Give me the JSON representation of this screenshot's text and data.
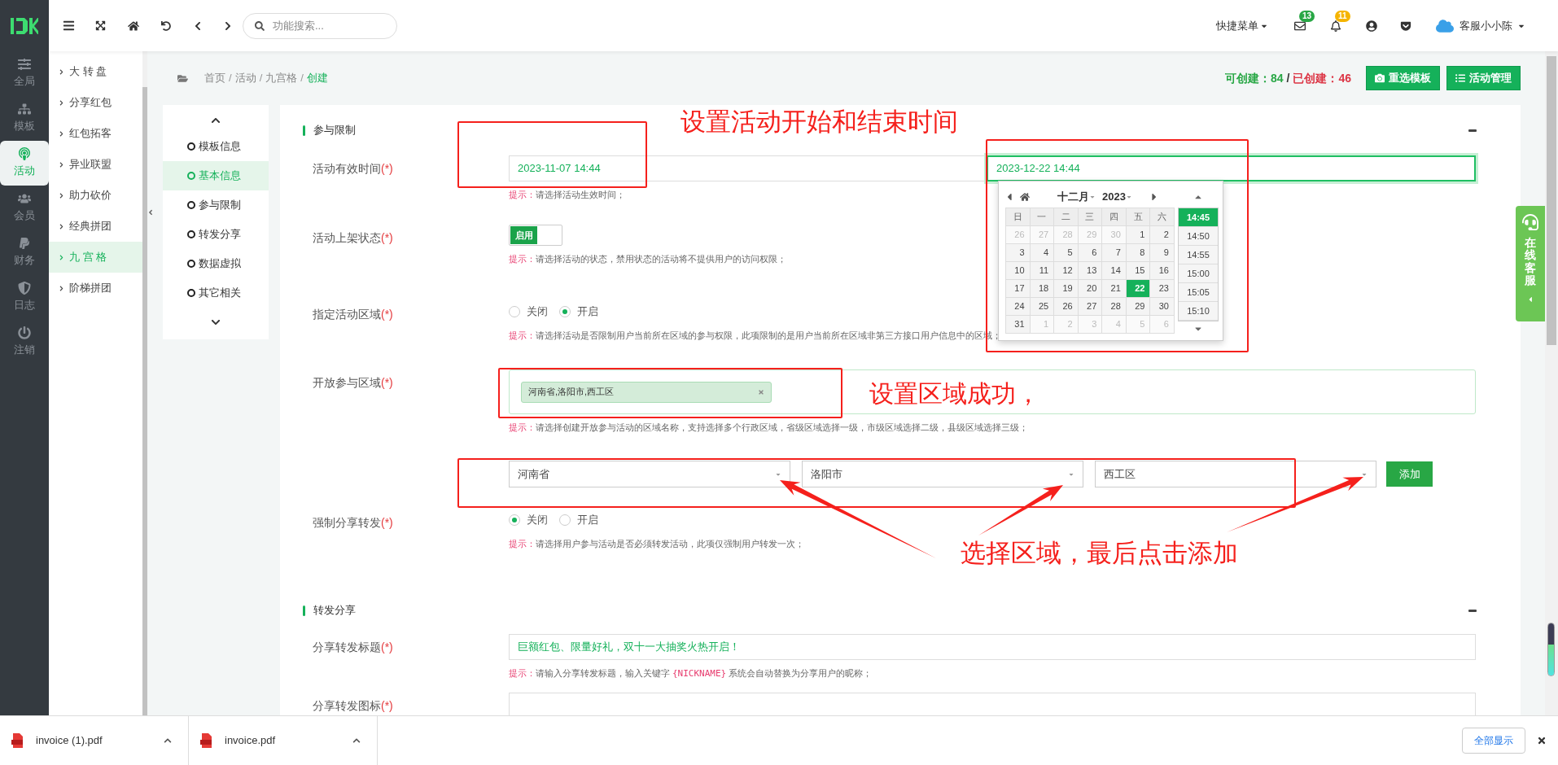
{
  "rail": [
    {
      "label": "全局",
      "selected": false
    },
    {
      "label": "模板",
      "selected": false
    },
    {
      "label": "活动",
      "selected": true
    },
    {
      "label": "会员",
      "selected": false
    },
    {
      "label": "财务",
      "selected": false
    },
    {
      "label": "日志",
      "selected": false
    },
    {
      "label": "注销",
      "selected": false
    }
  ],
  "topbar": {
    "search": {
      "placeholder": "功能搜索..."
    },
    "quick_menu": "快捷菜单",
    "mail_badge": "13",
    "bell_badge": "11",
    "user": "客服小小陈"
  },
  "submenu": [
    {
      "label": "大 转 盘",
      "selected": false
    },
    {
      "label": "分享红包",
      "selected": false
    },
    {
      "label": "红包拓客",
      "selected": false
    },
    {
      "label": "异业联盟",
      "selected": false
    },
    {
      "label": "助力砍价",
      "selected": false
    },
    {
      "label": "经典拼团",
      "selected": false
    },
    {
      "label": "九 宫 格",
      "selected": true
    },
    {
      "label": "阶梯拼团",
      "selected": false
    }
  ],
  "breadcrumb": {
    "separator": "/",
    "items": [
      {
        "label": "首页",
        "current": false
      },
      {
        "label": "活动",
        "current": false
      },
      {
        "label": "九宫格",
        "current": false
      },
      {
        "label": "创建",
        "current": true
      }
    ]
  },
  "quota": {
    "available": "可创建：84",
    "separator": "/",
    "created": "已创建：46"
  },
  "actions": [
    "重选模板",
    "活动管理"
  ],
  "anchor_nav": [
    {
      "label": "模板信息",
      "selected": false
    },
    {
      "label": "基本信息",
      "selected": true
    },
    {
      "label": "参与限制",
      "selected": false
    },
    {
      "label": "转发分享",
      "selected": false
    },
    {
      "label": "数据虚拟",
      "selected": false
    },
    {
      "label": "其它相关",
      "selected": false
    }
  ],
  "sections": [
    {
      "title": "参与限制",
      "fields": [
        {
          "kind": "daterange",
          "label": "活动有效时间",
          "required": "(*)",
          "start": "2023-11-07 14:44",
          "end": "2023-12-22 14:44",
          "hint_label": "提示：",
          "hint": "请选择活动生效时间；"
        },
        {
          "kind": "toggle",
          "label": "活动上架状态",
          "required": "(*)",
          "on": true,
          "on_text": "启用",
          "hint_label": "提示：",
          "hint": "请选择活动的状态，禁用状态的活动将不提供用户的访问权限；"
        },
        {
          "kind": "radio",
          "label": "指定活动区域",
          "required": "(*)",
          "options": [
            {
              "label": "关闭",
              "selected": false
            },
            {
              "label": "开启",
              "selected": true
            }
          ],
          "hint_label": "提示：",
          "hint": " 请选择活动是否限制用户当前所在区域的参与权限，此项限制的是用户当前所在区域非第三方接口用户信息中的区域；"
        },
        {
          "kind": "tags",
          "label": "开放参与区域",
          "required": "(*)",
          "tags": [
            {
              "label": "河南省,洛阳市,西工区"
            }
          ],
          "hint_label": "提示：",
          "hint": " 请选择创建开放参与活动的区域名称，支持选择多个行政区域，省级区域选择一级，市级区域选择二级，县级区域选择三级；"
        },
        {
          "kind": "selects",
          "selects": [
            {
              "value": "河南省"
            },
            {
              "value": "洛阳市"
            },
            {
              "value": "西工区"
            }
          ],
          "button": "添加"
        },
        {
          "kind": "radio",
          "label": "强制分享转发",
          "required": "(*)",
          "options": [
            {
              "label": "关闭",
              "selected": true
            },
            {
              "label": "开启",
              "selected": false
            }
          ],
          "hint_label": "提示：",
          "hint": " 请选择用户参与活动是否必须转发活动，此项仅强制用户转发一次；"
        }
      ]
    },
    {
      "title": "转发分享",
      "fields": [
        {
          "kind": "text",
          "label": "分享转发标题",
          "required": "(*)",
          "value": "巨额红包、限量好礼，双十一大抽奖火热开启！",
          "hint_label": "提示：",
          "hint": "请输入分享转发标题，输入关键字",
          "hint_code": "{NICKNAME}",
          "hint_after": "系统会自动替换为分享用户的昵称；"
        },
        {
          "kind": "image",
          "label": "分享转发图标",
          "required": "(*)"
        }
      ]
    }
  ],
  "calendar": {
    "month": "十二月",
    "year": "2023",
    "weekdays": [
      "日",
      "一",
      "二",
      "三",
      "四",
      "五",
      "六"
    ],
    "weeks": [
      [
        {
          "label": "26",
          "muted": true,
          "selected": false
        },
        {
          "label": "27",
          "muted": true,
          "selected": false
        },
        {
          "label": "28",
          "muted": true,
          "selected": false
        },
        {
          "label": "29",
          "muted": true,
          "selected": false
        },
        {
          "label": "30",
          "muted": true,
          "selected": false
        },
        {
          "label": "1",
          "muted": false,
          "selected": false
        },
        {
          "label": "2",
          "muted": false,
          "selected": false
        }
      ],
      [
        {
          "label": "3",
          "muted": false,
          "selected": false
        },
        {
          "label": "4",
          "muted": false,
          "selected": false
        },
        {
          "label": "5",
          "muted": false,
          "selected": false
        },
        {
          "label": "6",
          "muted": false,
          "selected": false
        },
        {
          "label": "7",
          "muted": false,
          "selected": false
        },
        {
          "label": "8",
          "muted": false,
          "selected": false
        },
        {
          "label": "9",
          "muted": false,
          "selected": false
        }
      ],
      [
        {
          "label": "10",
          "muted": false,
          "selected": false
        },
        {
          "label": "11",
          "muted": false,
          "selected": false
        },
        {
          "label": "12",
          "muted": false,
          "selected": false
        },
        {
          "label": "13",
          "muted": false,
          "selected": false
        },
        {
          "label": "14",
          "muted": false,
          "selected": false
        },
        {
          "label": "15",
          "muted": false,
          "selected": false
        },
        {
          "label": "16",
          "muted": false,
          "selected": false
        }
      ],
      [
        {
          "label": "17",
          "muted": false,
          "selected": false
        },
        {
          "label": "18",
          "muted": false,
          "selected": false
        },
        {
          "label": "19",
          "muted": false,
          "selected": false
        },
        {
          "label": "20",
          "muted": false,
          "selected": false
        },
        {
          "label": "21",
          "muted": false,
          "selected": false
        },
        {
          "label": "22",
          "muted": false,
          "selected": true
        },
        {
          "label": "23",
          "muted": false,
          "selected": false
        }
      ],
      [
        {
          "label": "24",
          "muted": false,
          "selected": false
        },
        {
          "label": "25",
          "muted": false,
          "selected": false
        },
        {
          "label": "26",
          "muted": false,
          "selected": false
        },
        {
          "label": "27",
          "muted": false,
          "selected": false
        },
        {
          "label": "28",
          "muted": false,
          "selected": false
        },
        {
          "label": "29",
          "muted": false,
          "selected": false
        },
        {
          "label": "30",
          "muted": false,
          "selected": false
        }
      ],
      [
        {
          "label": "31",
          "muted": false,
          "selected": false
        },
        {
          "label": "1",
          "muted": true,
          "selected": false
        },
        {
          "label": "2",
          "muted": true,
          "selected": false
        },
        {
          "label": "3",
          "muted": true,
          "selected": false
        },
        {
          "label": "4",
          "muted": true,
          "selected": false
        },
        {
          "label": "5",
          "muted": true,
          "selected": false
        },
        {
          "label": "6",
          "muted": true,
          "selected": false
        }
      ]
    ],
    "times": [
      {
        "label": "14:45",
        "selected": true
      },
      {
        "label": "14:50",
        "selected": false
      },
      {
        "label": "14:55",
        "selected": false
      },
      {
        "label": "15:00",
        "selected": false
      },
      {
        "label": "15:05",
        "selected": false
      },
      {
        "label": "15:10",
        "selected": false
      }
    ]
  },
  "service_tab": "在线客服",
  "annotations": [
    "设置活动开始和结束时间",
    "设置区域成功，",
    "选择区域，最后点击添加"
  ],
  "downloads": {
    "files": [
      {
        "name": "invoice (1).pdf"
      },
      {
        "name": "invoice.pdf"
      }
    ],
    "show_all": "全部显示"
  }
}
